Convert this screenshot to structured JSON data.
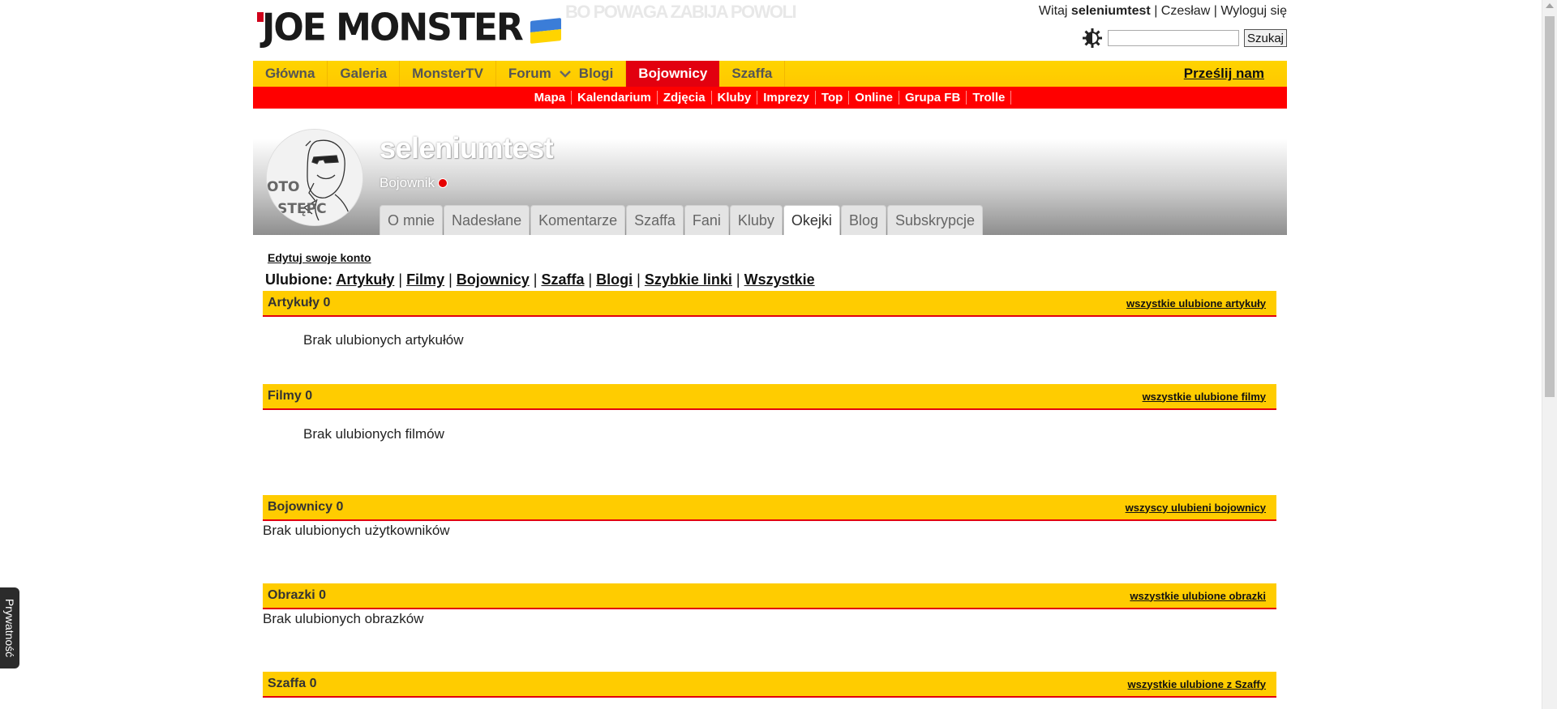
{
  "header": {
    "logo_text": "JOE MONSTER",
    "tagline": "BO POWAGA ZABIJA POWOLI",
    "greeting_prefix": "Witaj",
    "username": "seleniumtest",
    "link_1": "Czesław",
    "link_2": "Wyloguj się",
    "separator": "|",
    "search_placeholder": "",
    "search_button": "Szukaj"
  },
  "main_nav": {
    "items": [
      "Główna",
      "Galeria",
      "MonsterTV",
      "Forum",
      "Blogi",
      "Bojownicy",
      "Szaffa"
    ],
    "active": "Bojownicy",
    "send_link": "Prześlij nam"
  },
  "sub_nav": {
    "items": [
      "Mapa",
      "Kalendarium",
      "Zdjęcia",
      "Kluby",
      "Imprezy",
      "Top",
      "Online",
      "Grupa FB",
      "Trolle"
    ]
  },
  "profile": {
    "name": "seleniumtest",
    "rank": "Bojownik",
    "avatar_text_1": "OTO",
    "avatar_text_2": "ASTĘPC",
    "tabs": [
      "O mnie",
      "Nadesłane",
      "Komentarze",
      "Szaffa",
      "Fani",
      "Kluby",
      "Okejki",
      "Blog",
      "Subskrypcje"
    ],
    "active_tab": "Okejki"
  },
  "content": {
    "edit_link": "Edytuj swoje konto",
    "favorites_label": "Ulubione:",
    "favorites_links": [
      "Artykuły",
      "Filmy",
      "Bojownicy",
      "Szaffa",
      "Blogi",
      "Szybkie linki",
      "Wszystkie"
    ],
    "sections": [
      {
        "title": "Artykuły 0",
        "link": "wszystkie ulubione artykuły",
        "empty": "Brak ulubionych artykułów"
      },
      {
        "title": "Filmy 0",
        "link": "wszystkie ulubione filmy",
        "empty": "Brak ulubionych filmów"
      },
      {
        "title": "Bojownicy 0",
        "link": "wszyscy ulubieni bojownicy",
        "empty": "Brak ulubionych użytkowników"
      },
      {
        "title": "Obrazki 0",
        "link": "wszystkie ulubione obrazki",
        "empty": "Brak ulubionych obrazków"
      },
      {
        "title": "Szaffa 0",
        "link": "wszystkie ulubione z Szaffy"
      }
    ]
  },
  "privacy_tab": "Prywatność",
  "colors": {
    "nav_yellow": "#ffcc00",
    "nav_red": "#e2000f",
    "subnav_red": "#ff0000"
  },
  "icons": {
    "theme_toggle": "half-moon-gear-icon",
    "chevron": "chevron-down-icon",
    "status": "status-dot-icon"
  }
}
